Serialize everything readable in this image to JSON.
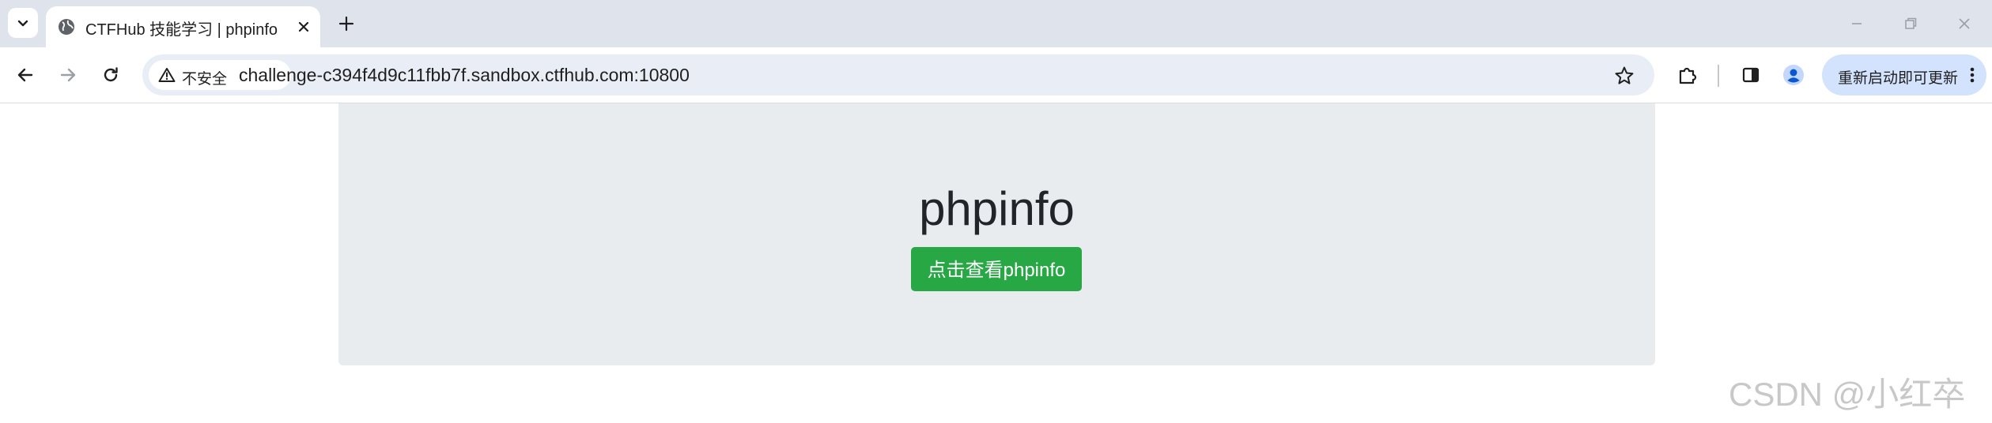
{
  "browser": {
    "tab": {
      "title": "CTFHub 技能学习 | phpinfo",
      "favicon": "globe-icon",
      "close_icon": "close-icon"
    },
    "new_tab_icon": "plus-icon",
    "tab_search_icon": "chevron-down-icon",
    "window_controls": [
      "minimize-icon",
      "restore-icon",
      "close-icon"
    ],
    "toolbar": {
      "back_icon": "arrow-left-icon",
      "forward_icon": "arrow-right-icon",
      "reload_icon": "reload-icon",
      "security_label": "不安全",
      "security_icon": "warning-triangle-icon",
      "url_host": "challenge-c394f4d9c11fbb7f.sandbox.ctfhub.com",
      "url_port": ":10800",
      "bookmark_icon": "star-icon",
      "extensions_icon": "puzzle-icon",
      "side_panel_icon": "side-panel-icon",
      "profile_icon": "profile-icon",
      "update_label": "重新启动即可更新",
      "menu_icon": "kebab-menu-icon"
    }
  },
  "page": {
    "heading": "phpinfo",
    "button_label": "点击查看phpinfo",
    "button_color": "#28a745",
    "jumbotron_bg": "#e9ecef"
  },
  "watermark": "CSDN @小红卒"
}
